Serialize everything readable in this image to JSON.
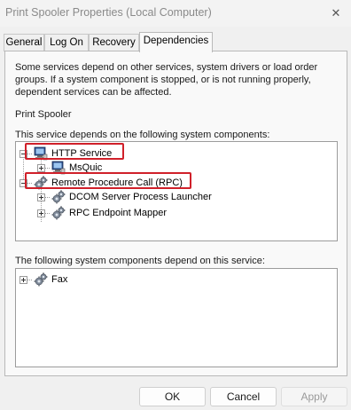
{
  "window": {
    "title": "Print Spooler Properties (Local Computer)",
    "close_glyph": "✕"
  },
  "tabs": [
    {
      "label": "General",
      "active": false
    },
    {
      "label": "Log On",
      "active": false
    },
    {
      "label": "Recovery",
      "active": false
    },
    {
      "label": "Dependencies",
      "active": true
    }
  ],
  "dependencies": {
    "description_lines": [
      "Some services depend on other services, system drivers or load order",
      "groups. If a system component is stopped, or is not running properly,",
      "dependent services can be affected."
    ],
    "service_name": "Print Spooler",
    "depends_on_label": "This service depends on the following system components:",
    "depends_on_tree": [
      {
        "label": "HTTP Service",
        "icon": "driver-icon",
        "expanded": true,
        "highlighted": true,
        "children": [
          {
            "label": "MsQuic",
            "icon": "driver-icon"
          }
        ]
      },
      {
        "label": "Remote Procedure Call (RPC)",
        "icon": "service-gear-icon",
        "expanded": true,
        "highlighted": true,
        "children": [
          {
            "label": "DCOM Server Process Launcher",
            "icon": "service-gear-icon"
          },
          {
            "label": "RPC Endpoint Mapper",
            "icon": "service-gear-icon"
          }
        ]
      }
    ],
    "dependents_label": "The following system components depend on this service:",
    "dependents_tree": [
      {
        "label": "Fax",
        "icon": "service-gear-icon",
        "expanded": false
      }
    ]
  },
  "buttons": {
    "ok": "OK",
    "cancel": "Cancel",
    "apply": "Apply"
  },
  "colors": {
    "highlight": "#d0202a",
    "disabled_text": "#9a9a9a"
  }
}
